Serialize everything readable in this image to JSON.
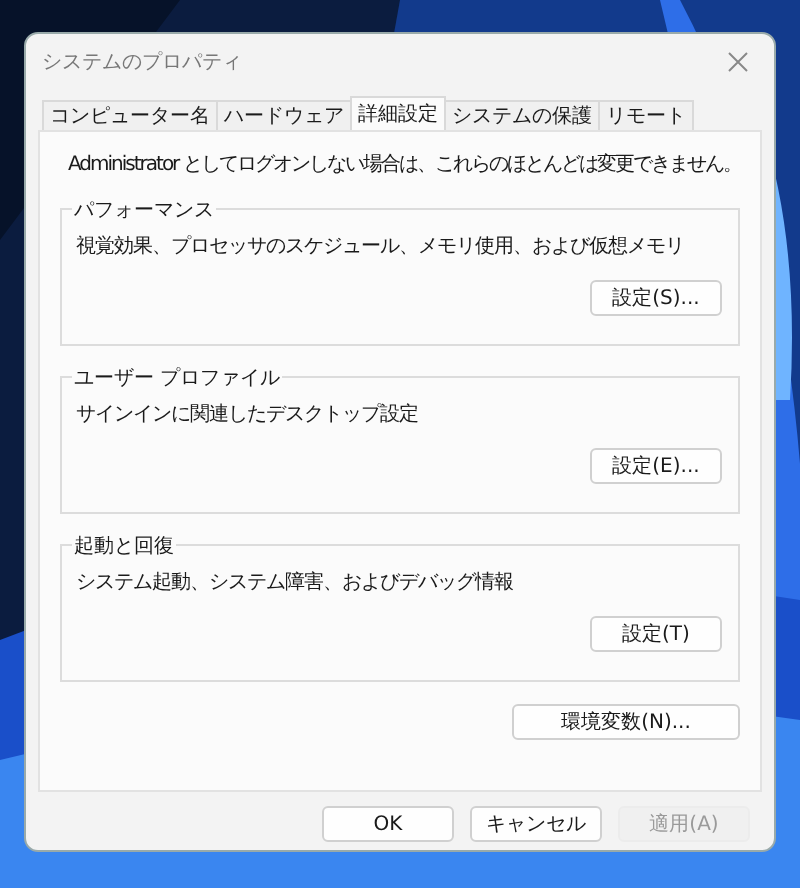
{
  "window": {
    "title": "システムのプロパティ"
  },
  "tabs": [
    {
      "label": "コンピューター名",
      "selected": false
    },
    {
      "label": "ハードウェア",
      "selected": false
    },
    {
      "label": "詳細設定",
      "selected": true
    },
    {
      "label": "システムの保護",
      "selected": false
    },
    {
      "label": "リモート",
      "selected": false
    }
  ],
  "notice": "Administrator としてログオンしない場合は、これらのほとんどは変更できません。",
  "groups": [
    {
      "title": "パフォーマンス",
      "description": "視覚効果、プロセッサのスケジュール、メモリ使用、および仮想メモリ",
      "button": "設定(S)..."
    },
    {
      "title": "ユーザー プロファイル",
      "description": "サインインに関連したデスクトップ設定",
      "button": "設定(E)..."
    },
    {
      "title": "起動と回復",
      "description": "システム起動、システム障害、およびデバッグ情報",
      "button": "設定(T)"
    }
  ],
  "env_button": "環境変数(N)...",
  "buttons": [
    {
      "label": "OK",
      "disabled": false
    },
    {
      "label": "キャンセル",
      "disabled": false
    },
    {
      "label": "適用(A)",
      "disabled": true
    }
  ]
}
